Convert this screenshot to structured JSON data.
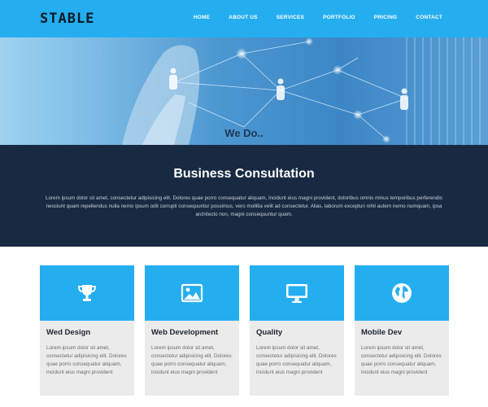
{
  "brand": {
    "logo_text": "STABLE"
  },
  "nav": {
    "items": [
      "HOME",
      "ABOUT US",
      "SERVICES",
      "PORTFOLIO",
      "PRICING",
      "CONTACT"
    ]
  },
  "hero": {
    "heading": "We Do.."
  },
  "intro": {
    "title": "Business Consultation",
    "body": "Lorem ipsum dolor sit amet, consectetur adipisicing elit. Dolores quae porro consequatur aliquam, incidunt eius magni provident, doloribus omnis minus temporibus perferendis nesciunt quam repellendus nulla nemo ipsum odit corrupti consequuntur possimus, vero mollitia velit ad consectetur. Alias, laborum excepturi nihil autem nemo numquam, ipsa architecto non, magni consequuntur quam."
  },
  "cards": [
    {
      "icon": "trophy-icon",
      "title": "Wed Design",
      "text": "Lorem ipsum dolor sit amet, consectetur adipisicing elit. Dolores quae porro consequatur aliquam, incidunt eius magni provident"
    },
    {
      "icon": "image-icon",
      "title": "Web Development",
      "text": "Lorem ipsum dolor sit amet, consectetur adipisicing elit. Dolores quae porro consequatur aliquam, incidunt eius magni provident"
    },
    {
      "icon": "monitor-icon",
      "title": "Quality",
      "text": "Lorem ipsum dolor sit amet, consectetur adipisicing elit. Dolores quae porro consequatur aliquam, incidunt eius magni provident"
    },
    {
      "icon": "globe-icon",
      "title": "Mobile Dev",
      "text": "Lorem ipsum dolor sit amet, consectetur adipisicing elit. Dolores quae porro consequatur aliquam, incidunt eius magni provident"
    }
  ],
  "colors": {
    "accent": "#24aef0",
    "dark_band": "#182a42",
    "card_bg": "#ebebeb"
  }
}
